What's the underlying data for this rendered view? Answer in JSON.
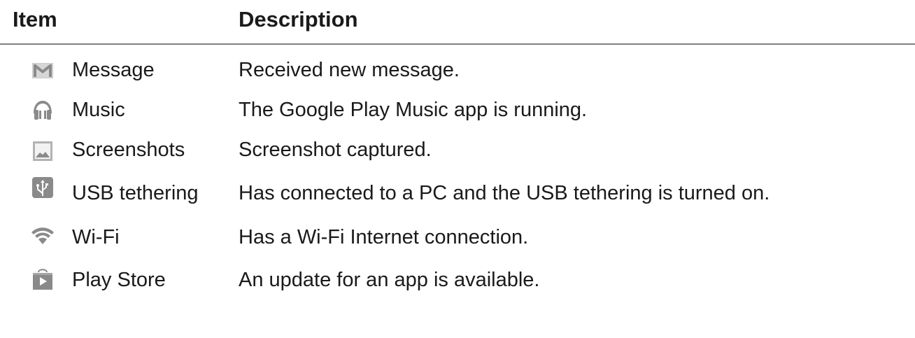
{
  "table": {
    "headers": {
      "item": "Item",
      "description": "Description"
    },
    "rows": [
      {
        "icon": "gmail-envelope-icon",
        "item": "Message",
        "description": "Received new message."
      },
      {
        "icon": "headphones-icon",
        "item": "Music",
        "description": "The Google Play Music app is running."
      },
      {
        "icon": "image-picture-icon",
        "item": "Screenshots",
        "description": "Screenshot captured."
      },
      {
        "icon": "usb-icon",
        "item": "USB tethering",
        "description": "Has connected to a PC and the USB tethering is turned on."
      },
      {
        "icon": "wifi-icon",
        "item": "Wi-Fi",
        "description": "Has a Wi-Fi Internet connection."
      },
      {
        "icon": "play-store-icon",
        "item": "Play Store",
        "description": "An update for an app is available."
      }
    ]
  },
  "colors": {
    "icon_gray": "#8a8a8a",
    "icon_light": "#b3b3b3",
    "text": "#1a1a1a",
    "rule": "#7f7f7f"
  }
}
